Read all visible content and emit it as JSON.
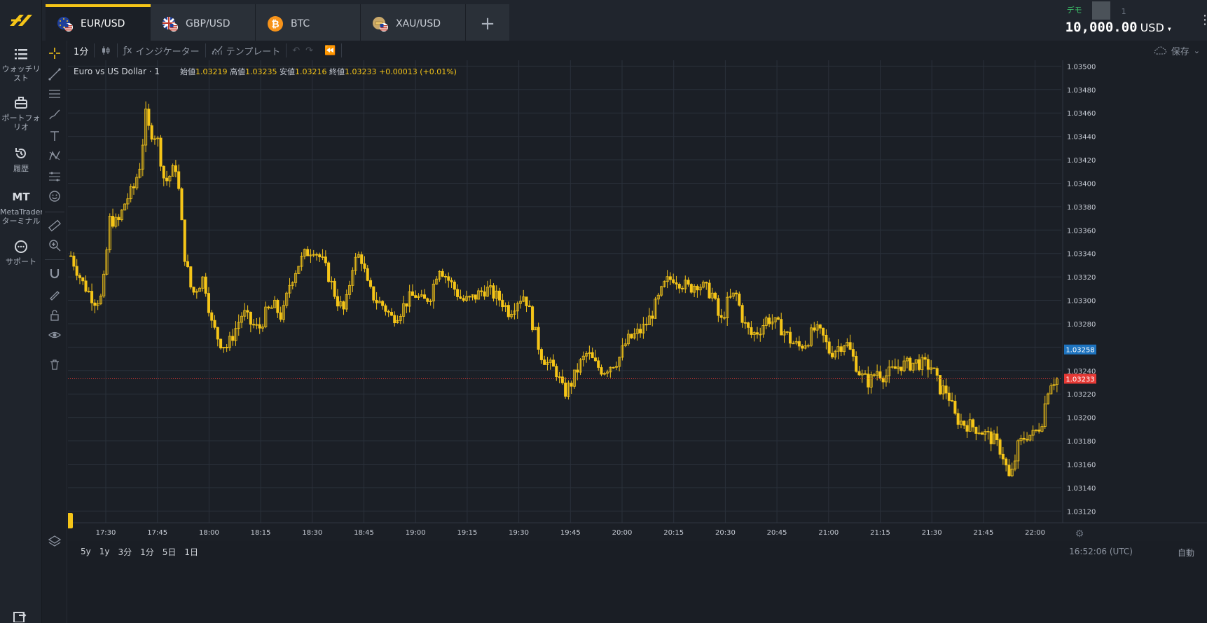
{
  "nav": {
    "items": [
      {
        "label1": "ウォッチリ",
        "label2": "スト"
      },
      {
        "label1": "ポートフォ",
        "label2": "リオ"
      },
      {
        "label1": "履歴",
        "label2": ""
      },
      {
        "mark": "MT",
        "label1": "MetaTrader",
        "label2": "ターミナル"
      },
      {
        "label1": "サポート",
        "label2": ""
      }
    ]
  },
  "tabs": [
    {
      "label": "EUR/USD",
      "icon": "eu-flag-icon",
      "active": true
    },
    {
      "label": "GBP/USD",
      "icon": "uk-flag-icon",
      "active": false
    },
    {
      "label": "BTC",
      "icon": "bitcoin-icon",
      "active": false
    },
    {
      "label": "XAU/USD",
      "icon": "gold-icon",
      "active": false
    }
  ],
  "add_tab": "+",
  "account": {
    "mode": "デモ",
    "number": "1",
    "balance": "10,000.00",
    "currency": "USD"
  },
  "toolbar": {
    "interval": "1分",
    "indicators": "インジケーター",
    "templates": "テンプレート",
    "save": "保存"
  },
  "legend": {
    "symbol": "Euro vs US Dollar · 1",
    "open_label": "始値",
    "open": "1.03219",
    "high_label": "高値",
    "high": "1.03235",
    "low_label": "安値",
    "low": "1.03216",
    "close_label": "終値",
    "close": "1.03233",
    "change": "+0.00013 (+0.01%)"
  },
  "bottom": {
    "ranges": [
      "5y",
      "1y",
      "3分",
      "1分",
      "5日",
      "1日"
    ],
    "clock": "16:52:06 (UTC)",
    "auto": "自動"
  },
  "colors": {
    "candle": "#f5c518",
    "bid": "#1e73be",
    "ask": "#e53935",
    "grid": "#2a303a",
    "bg": "#1b1f26"
  },
  "chart_data": {
    "type": "candlestick",
    "x_tick_labels": [
      "17:30",
      "17:45",
      "18:00",
      "18:15",
      "18:30",
      "18:45",
      "19:00",
      "19:15",
      "19:30",
      "19:45",
      "20:00",
      "20:15",
      "20:30",
      "20:45",
      "21:00",
      "21:15",
      "21:30",
      "21:45",
      "22:00"
    ],
    "y_tick_labels": [
      "1.03500",
      "1.03480",
      "1.03460",
      "1.03440",
      "1.03420",
      "1.03400",
      "1.03380",
      "1.03360",
      "1.03340",
      "1.03320",
      "1.03300",
      "1.03280",
      "1.03260",
      "1.03240",
      "1.03220",
      "1.03200",
      "1.03180",
      "1.03160",
      "1.03140",
      "1.03120"
    ],
    "ylim": [
      1.0311,
      1.03505
    ],
    "price_markers": [
      {
        "label": "1.03258",
        "value": 1.03258,
        "color": "#1e73be"
      },
      {
        "label": "1.03233",
        "value": 1.03233,
        "color": "#e53935"
      }
    ],
    "close_path": [
      [
        0,
        1.03338
      ],
      [
        3,
        1.03315
      ],
      [
        6,
        1.033
      ],
      [
        8,
        1.03302
      ],
      [
        10,
        1.0337
      ],
      [
        12,
        1.03365
      ],
      [
        14,
        1.03385
      ],
      [
        16,
        1.03395
      ],
      [
        18,
        1.0342
      ],
      [
        19,
        1.0346
      ],
      [
        20,
        1.03445
      ],
      [
        22,
        1.0344
      ],
      [
        24,
        1.034
      ],
      [
        26,
        1.0341
      ],
      [
        27,
        1.03415
      ],
      [
        29,
        1.0334
      ],
      [
        31,
        1.03305
      ],
      [
        32,
        1.0331
      ],
      [
        34,
        1.0332
      ],
      [
        36,
        1.0328
      ],
      [
        38,
        1.03265
      ],
      [
        40,
        1.0326
      ],
      [
        42,
        1.03275
      ],
      [
        44,
        1.0329
      ],
      [
        46,
        1.0328
      ],
      [
        48,
        1.03275
      ],
      [
        50,
        1.0329
      ],
      [
        52,
        1.03295
      ],
      [
        54,
        1.03285
      ],
      [
        56,
        1.03315
      ],
      [
        58,
        1.0333
      ],
      [
        60,
        1.0334
      ],
      [
        62,
        1.03345
      ],
      [
        64,
        1.03335
      ],
      [
        66,
        1.0332
      ],
      [
        68,
        1.033
      ],
      [
        70,
        1.0329
      ],
      [
        72,
        1.0333
      ],
      [
        74,
        1.0334
      ],
      [
        76,
        1.0331
      ],
      [
        78,
        1.033
      ],
      [
        80,
        1.03295
      ],
      [
        82,
        1.03285
      ],
      [
        84,
        1.0329
      ],
      [
        86,
        1.033
      ],
      [
        88,
        1.03305
      ],
      [
        90,
        1.03298
      ],
      [
        92,
        1.03305
      ],
      [
        94,
        1.0333
      ],
      [
        96,
        1.0332
      ],
      [
        98,
        1.0331
      ],
      [
        100,
        1.033
      ],
      [
        102,
        1.033
      ],
      [
        104,
        1.03305
      ],
      [
        106,
        1.0331
      ],
      [
        108,
        1.03305
      ],
      [
        110,
        1.033
      ],
      [
        112,
        1.0329
      ],
      [
        114,
        1.033
      ],
      [
        116,
        1.03305
      ],
      [
        118,
        1.0328
      ],
      [
        120,
        1.03255
      ],
      [
        122,
        1.03245
      ],
      [
        124,
        1.0324
      ],
      [
        126,
        1.0322
      ],
      [
        128,
        1.0323
      ],
      [
        130,
        1.03245
      ],
      [
        132,
        1.03255
      ],
      [
        134,
        1.03245
      ],
      [
        136,
        1.0324
      ],
      [
        138,
        1.03245
      ],
      [
        140,
        1.0325
      ],
      [
        142,
        1.03265
      ],
      [
        144,
        1.0327
      ],
      [
        146,
        1.03275
      ],
      [
        148,
        1.03285
      ],
      [
        150,
        1.033
      ],
      [
        152,
        1.03315
      ],
      [
        154,
        1.0332
      ],
      [
        156,
        1.03315
      ],
      [
        158,
        1.0331
      ],
      [
        160,
        1.03315
      ],
      [
        162,
        1.0331
      ],
      [
        164,
        1.03305
      ],
      [
        166,
        1.0328
      ],
      [
        168,
        1.033
      ],
      [
        170,
        1.03305
      ],
      [
        172,
        1.0328
      ],
      [
        174,
        1.0327
      ],
      [
        176,
        1.03275
      ],
      [
        178,
        1.03285
      ],
      [
        180,
        1.0328
      ],
      [
        182,
        1.03275
      ],
      [
        184,
        1.03265
      ],
      [
        186,
        1.0326
      ],
      [
        188,
        1.03265
      ],
      [
        190,
        1.03275
      ],
      [
        192,
        1.0327
      ],
      [
        194,
        1.03255
      ],
      [
        196,
        1.0326
      ],
      [
        198,
        1.03265
      ],
      [
        200,
        1.0325
      ],
      [
        202,
        1.03235
      ],
      [
        204,
        1.0323
      ],
      [
        206,
        1.0324
      ],
      [
        208,
        1.03235
      ],
      [
        210,
        1.0324
      ],
      [
        212,
        1.03245
      ],
      [
        214,
        1.03245
      ],
      [
        216,
        1.03247
      ],
      [
        218,
        1.03245
      ],
      [
        220,
        1.03243
      ],
      [
        222,
        1.03225
      ],
      [
        224,
        1.03222
      ],
      [
        226,
        1.032
      ],
      [
        228,
        1.03195
      ],
      [
        230,
        1.03193
      ],
      [
        232,
        1.0319
      ],
      [
        234,
        1.03185
      ],
      [
        236,
        1.0318
      ],
      [
        238,
        1.0317
      ],
      [
        240,
        1.03145
      ],
      [
        242,
        1.03175
      ],
      [
        244,
        1.03185
      ],
      [
        246,
        1.03185
      ],
      [
        248,
        1.03195
      ],
      [
        250,
        1.0323
      ],
      [
        252,
        1.03233
      ]
    ]
  }
}
